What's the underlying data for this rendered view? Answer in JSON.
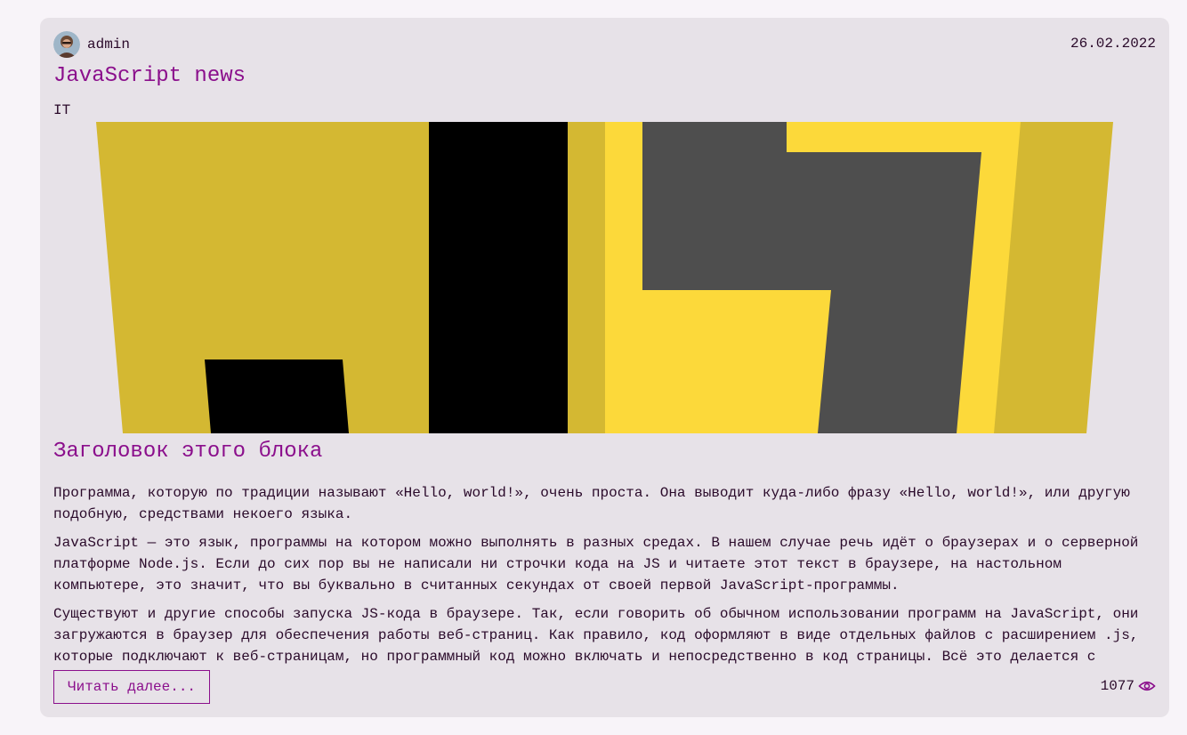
{
  "post": {
    "author": "admin",
    "date": "26.02.2022",
    "title": "JavaScript news",
    "category": "IT",
    "block_title": "Заголовок этого блока",
    "paragraphs": [
      "Программа, которую по традиции называют «Hello, world!», очень проста. Она выводит куда-либо фразу «Hello, world!», или другую подобную, средствами некоего языка.",
      "JavaScript — это язык, программы на котором можно выполнять в разных средах. В нашем случае речь идёт о браузерах и о серверной платформе Node.js. Если до сих пор вы не написали ни строчки кода на JS и читаете этот текст в браузере, на настольном компьютере, это значит, что вы буквально в считанных секундах от своей первой JavaScript-программы.",
      "Существуют и другие способы запуска JS-кода в браузере. Так, если говорить об обычном использовании программ на JavaScript, они загружаются в браузер для обеспечения работы веб-страниц. Как правило, код оформляют в виде отдельных файлов с расширением .js, которые подключают к веб-страницам, но программный код можно включать и непосредственно в код страницы. Всё это делается с помощью тега script."
    ],
    "read_more_label": "Читать далее...",
    "views": "1077"
  },
  "icons": {
    "avatar": "user-avatar",
    "views": "eye-icon"
  },
  "colors": {
    "accent": "#8b0f8c",
    "card_bg": "#e7e2e8",
    "page_bg": "#f8f4f9",
    "js_yellow_dark": "#d4b832",
    "js_yellow": "#fcd93a",
    "js_gray": "#4e4e4e"
  }
}
